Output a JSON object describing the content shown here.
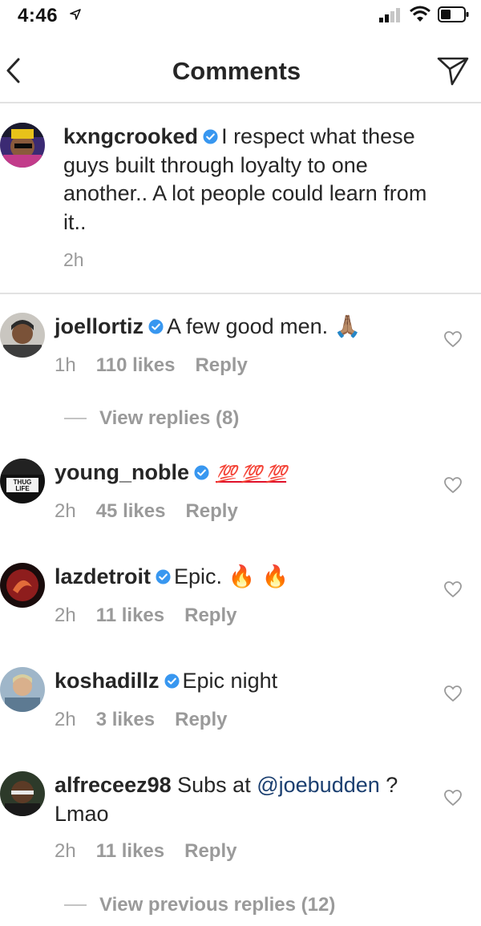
{
  "status_bar": {
    "time": "4:46"
  },
  "nav": {
    "title": "Comments"
  },
  "caption": {
    "username": "kxngcrooked",
    "text": "I respect what these guys built through loyalty to one another.. A lot people could learn from it..",
    "time": "2h"
  },
  "comments": [
    {
      "username": "joellortiz",
      "text": "A few good men.",
      "emoji": "🙏🏽",
      "time": "1h",
      "likes": "110 likes",
      "reply": "Reply"
    },
    {
      "username": "young_noble",
      "text": "",
      "emoji": "💯 💯 💯",
      "time": "2h",
      "likes": "45 likes",
      "reply": "Reply"
    },
    {
      "username": "lazdetroit",
      "text": "Epic.",
      "emoji": "🔥 🔥",
      "time": "2h",
      "likes": "11 likes",
      "reply": "Reply"
    },
    {
      "username": "koshadillz",
      "text": "Epic night",
      "emoji": "",
      "time": "2h",
      "likes": "3 likes",
      "reply": "Reply"
    },
    {
      "username": "alfreceez98",
      "text": "Subs at",
      "mention": "@joebudden",
      "text_after": "? Lmao",
      "time": "2h",
      "likes": "11 likes",
      "reply": "Reply"
    }
  ],
  "view_replies_1": "View replies (8)",
  "view_replies_2": "View previous replies (12)",
  "colors": {
    "verified": "#3897f0",
    "mention": "#1b3f70",
    "secondary_text": "#9a9a9a",
    "divider": "#e2e2e2"
  }
}
